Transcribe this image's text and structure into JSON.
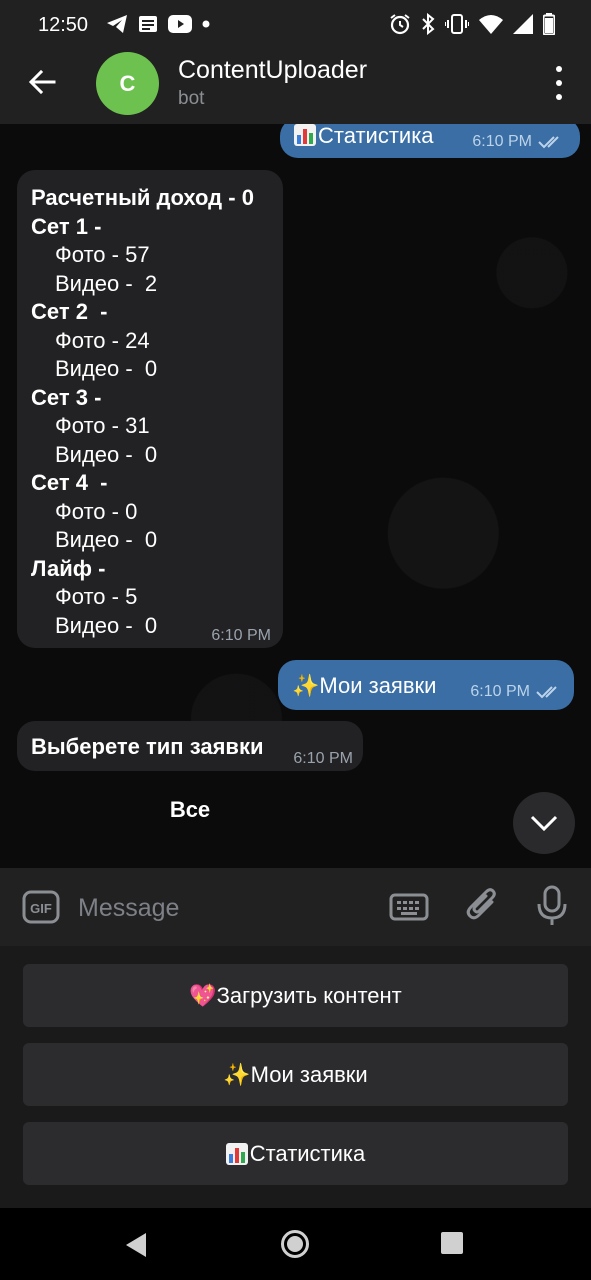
{
  "status_bar": {
    "time": "12:50",
    "left_icons": [
      "telegram-icon",
      "news-icon",
      "youtube-icon",
      "dot-icon"
    ],
    "right_icons": [
      "alarm-icon",
      "bluetooth-icon",
      "vibrate-icon",
      "wifi-icon",
      "signal-icon",
      "battery-icon"
    ]
  },
  "header": {
    "avatar_letter": "C",
    "avatar_color": "#6dc24f",
    "title": "ContentUploader",
    "subtitle": "bot"
  },
  "messages": {
    "stat_out": {
      "text": "Статистика",
      "time": "6:10 PM"
    },
    "stats_in": {
      "lines": [
        {
          "text": "Расчетный доход - 0",
          "bold": true
        },
        {
          "text": "Сет 1 -",
          "bold": true
        },
        {
          "text": "Фото - 57",
          "bold": false
        },
        {
          "text": "Видео -  2",
          "bold": false
        },
        {
          "text": "Сет 2  -",
          "bold": true
        },
        {
          "text": "Фото - 24",
          "bold": false
        },
        {
          "text": "Видео -  0",
          "bold": false
        },
        {
          "text": "Сет 3 -",
          "bold": true
        },
        {
          "text": "Фото - 31",
          "bold": false
        },
        {
          "text": "Видео -  0",
          "bold": false
        },
        {
          "text": "Сет 4  -",
          "bold": true
        },
        {
          "text": "Фото - 0",
          "bold": false
        },
        {
          "text": "Видео -  0",
          "bold": false
        },
        {
          "text": "Лайф -",
          "bold": true
        },
        {
          "text": "Фото - 5",
          "bold": false
        },
        {
          "text": "Видео -  0",
          "bold": false
        }
      ],
      "time": "6:10 PM"
    },
    "requests_out": {
      "text": "✨Мои заявки",
      "time": "6:10 PM"
    },
    "type_in": {
      "text": "Выберете тип заявки",
      "time": "6:10 PM"
    },
    "inline_button": "Все"
  },
  "input": {
    "placeholder": "Message"
  },
  "keyboard": {
    "btn_upload": "💖Загрузить контент",
    "btn_requests": "✨Мои заявки",
    "btn_stats": "Статистика"
  },
  "colors": {
    "outgoing_bubble": "#3a6ea5",
    "incoming_bubble": "#222224",
    "header_bg": "#212121"
  }
}
